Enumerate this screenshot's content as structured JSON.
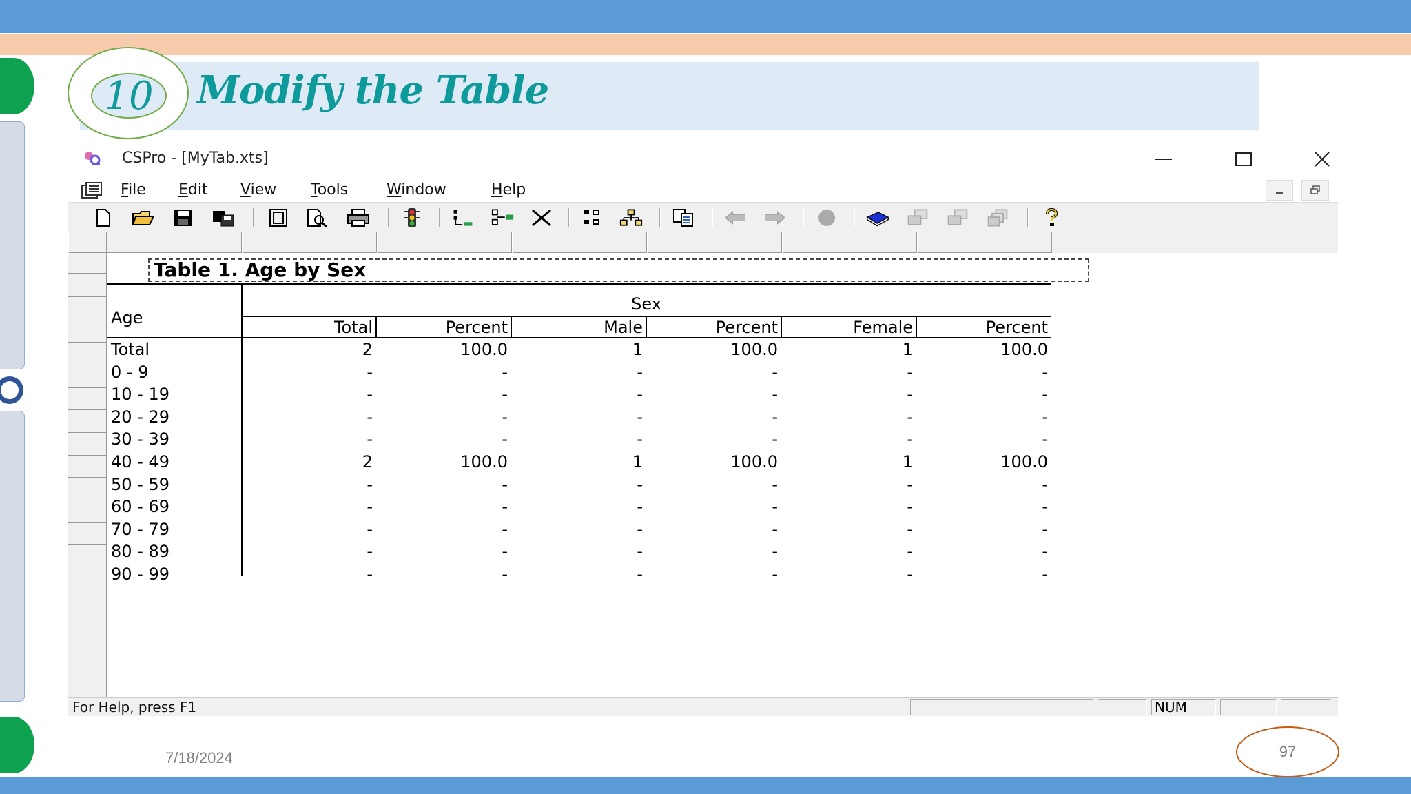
{
  "slide": {
    "number": "10",
    "title": "Modify the Table",
    "date": "7/18/2024",
    "page": "97"
  },
  "window": {
    "title": "CSPro - [MyTab.xts]",
    "menu": [
      {
        "underline": "F",
        "rest": "ile"
      },
      {
        "underline": "E",
        "rest": "dit"
      },
      {
        "underline": "V",
        "rest": "iew"
      },
      {
        "underline": "T",
        "rest": "ools"
      },
      {
        "underline": "W",
        "rest": "indow"
      },
      {
        "underline": "H",
        "rest": "elp"
      }
    ],
    "status": {
      "help": "For Help, press F1",
      "num": "NUM"
    }
  },
  "table": {
    "title": "Table 1. Age by Sex",
    "stub_header": "Age",
    "spanner": "Sex",
    "columns": [
      "Total",
      "Percent",
      "Male",
      "Percent",
      "Female",
      "Percent"
    ],
    "rows": [
      {
        "label": "Total",
        "values": [
          "2",
          "100.0",
          "1",
          "100.0",
          "1",
          "100.0"
        ]
      },
      {
        "label": "0 - 9",
        "values": [
          "-",
          "-",
          "-",
          "-",
          "-",
          "-"
        ]
      },
      {
        "label": "10 - 19",
        "values": [
          "-",
          "-",
          "-",
          "-",
          "-",
          "-"
        ]
      },
      {
        "label": "20 - 29",
        "values": [
          "-",
          "-",
          "-",
          "-",
          "-",
          "-"
        ]
      },
      {
        "label": "30 - 39",
        "values": [
          "-",
          "-",
          "-",
          "-",
          "-",
          "-"
        ]
      },
      {
        "label": "40 - 49",
        "values": [
          "2",
          "100.0",
          "1",
          "100.0",
          "1",
          "100.0"
        ]
      },
      {
        "label": "50 - 59",
        "values": [
          "-",
          "-",
          "-",
          "-",
          "-",
          "-"
        ]
      },
      {
        "label": "60 - 69",
        "values": [
          "-",
          "-",
          "-",
          "-",
          "-",
          "-"
        ]
      },
      {
        "label": "70 - 79",
        "values": [
          "-",
          "-",
          "-",
          "-",
          "-",
          "-"
        ]
      },
      {
        "label": "80 - 89",
        "values": [
          "-",
          "-",
          "-",
          "-",
          "-",
          "-"
        ]
      },
      {
        "label": "90 - 99",
        "values": [
          "-",
          "-",
          "-",
          "-",
          "-",
          "-"
        ]
      }
    ]
  },
  "colors": {
    "accent_teal": "#0e9a9a",
    "bar_blue": "#5b9bd5",
    "band_peach": "#f8cbad"
  }
}
